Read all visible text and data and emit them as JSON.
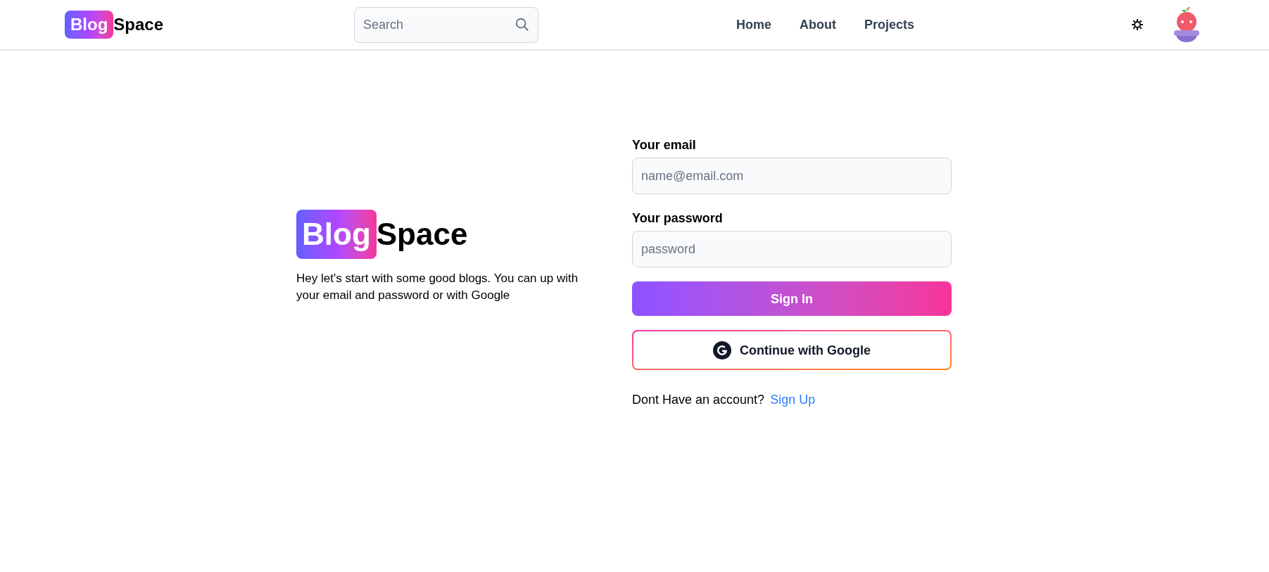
{
  "header": {
    "logo": {
      "highlight": "Blog",
      "rest": "Space"
    },
    "search": {
      "placeholder": "Search"
    },
    "nav": [
      {
        "label": "Home"
      },
      {
        "label": "About"
      },
      {
        "label": "Projects"
      }
    ]
  },
  "intro": {
    "logo": {
      "highlight": "Blog",
      "rest": "Space"
    },
    "text": "Hey let's start with some good blogs. You can up with your email and password or with Google"
  },
  "form": {
    "fields": [
      {
        "label": "Your email",
        "placeholder": "name@email.com"
      },
      {
        "label": "Your password",
        "placeholder": "password"
      }
    ],
    "submit": "Sign In",
    "google": "Continue with Google",
    "footer": {
      "text": "Dont Have an account?",
      "link": "Sign Up"
    }
  }
}
